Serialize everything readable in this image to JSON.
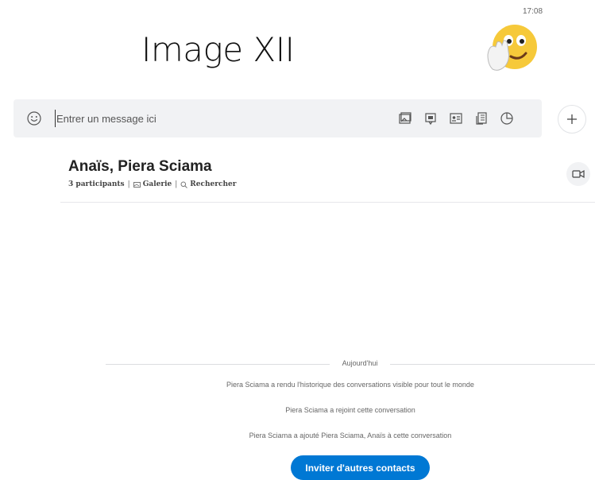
{
  "status": {
    "time": "17:08"
  },
  "header": {
    "title": "Image XII"
  },
  "composer": {
    "placeholder": "Entrer un message ici",
    "tools": [
      "gallery-icon",
      "video-message-icon",
      "contact-card-icon",
      "file-icon",
      "poll-icon"
    ]
  },
  "conversation": {
    "title": "Anaïs, Piera Sciama",
    "participants": "3 participants",
    "gallery_label": "Galerie",
    "search_label": "Rechercher"
  },
  "timeline": {
    "day_label": "Aujourd'hui",
    "messages": [
      "Piera Sciama a rendu l'historique des conversations visible pour tout le monde",
      "Piera Sciama a rejoint cette conversation",
      "Piera Sciama a ajouté Piera Sciama, Anaïs à cette conversation"
    ]
  },
  "actions": {
    "invite_label": "Inviter d'autres contacts"
  },
  "colors": {
    "accent": "#0078d4",
    "composer_bg": "#f1f2f4"
  }
}
